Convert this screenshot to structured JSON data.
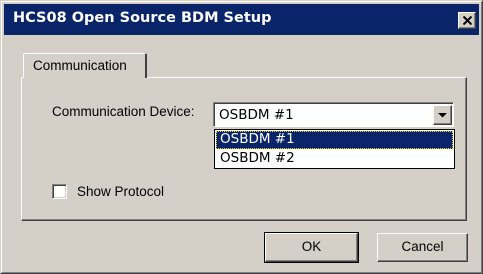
{
  "window": {
    "title": "HCS08 Open Source BDM Setup",
    "close_icon": "close-x-icon",
    "colors": {
      "titlebar": "#0a246a",
      "face": "#d4d0c8",
      "selection": "#0a246a"
    }
  },
  "tabs": [
    {
      "label": "Communication",
      "active": true
    }
  ],
  "communication": {
    "device_label": "Communication Device:",
    "device_selected": "OSBDM #1",
    "device_options": [
      "OSBDM #1",
      "OSBDM #2"
    ],
    "dropdown_open": true,
    "show_protocol_label": "Show Protocol",
    "show_protocol_checked": false
  },
  "buttons": {
    "ok_label": "OK",
    "cancel_label": "Cancel"
  }
}
